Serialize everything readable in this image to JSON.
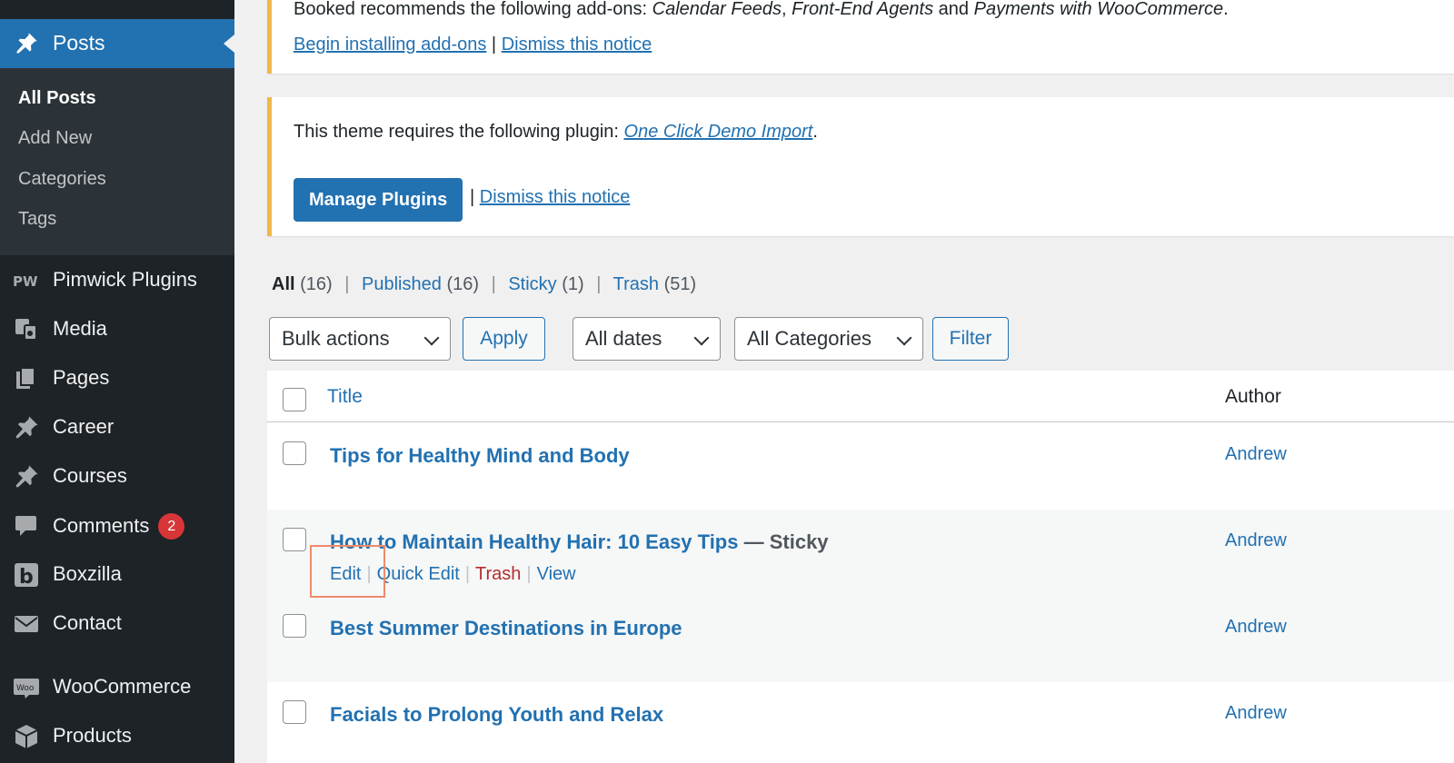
{
  "sidebar": {
    "current": {
      "label": "Posts",
      "icon": "pushpin-icon"
    },
    "submenu": [
      {
        "label": "All Posts",
        "current": true
      },
      {
        "label": "Add New"
      },
      {
        "label": "Categories"
      },
      {
        "label": "Tags"
      }
    ],
    "items": [
      {
        "label": "Pimwick Plugins",
        "icon": "pimwick-icon"
      },
      {
        "label": "Media",
        "icon": "media-icon"
      },
      {
        "label": "Pages",
        "icon": "pages-icon"
      },
      {
        "label": "Career",
        "icon": "pushpin-icon"
      },
      {
        "label": "Courses",
        "icon": "pushpin-icon"
      },
      {
        "label": "Comments",
        "icon": "comment-icon",
        "badge": "2"
      },
      {
        "label": "Boxzilla",
        "icon": "boxzilla-icon"
      },
      {
        "label": "Contact",
        "icon": "envelope-icon"
      },
      {
        "label": "WooCommerce",
        "icon": "woo-icon"
      },
      {
        "label": "Products",
        "icon": "products-icon"
      }
    ]
  },
  "notice1": {
    "text_prefix": "Booked recommends the following add-ons: ",
    "addon1": "Calendar Feeds",
    "sep1": ", ",
    "addon2": "Front-End Agents",
    "and": " and ",
    "addon3": "Payments with WooCommerce",
    "period": ".",
    "install_link": "Begin installing add-ons",
    "pipe": " | ",
    "dismiss_link": "Dismiss this notice"
  },
  "notice2": {
    "text_prefix": "This theme requires the following plugin: ",
    "plugin_link": "One Click Demo Import",
    "period": ".",
    "button": "Manage Plugins",
    "pipe": " | ",
    "dismiss_link": "Dismiss this notice"
  },
  "views": {
    "all": "All",
    "all_count": "(16)",
    "published": "Published",
    "published_count": "(16)",
    "sticky": "Sticky",
    "sticky_count": "(1)",
    "trash": "Trash",
    "trash_count": "(51)",
    "sep": "|"
  },
  "filters": {
    "bulk_actions": "Bulk actions",
    "apply": "Apply",
    "dates": "All dates",
    "categories": "All Categories",
    "filter": "Filter"
  },
  "table": {
    "col_title": "Title",
    "col_author": "Author",
    "rows": [
      {
        "title": "Tips for Healthy Mind and Body",
        "state": "",
        "author": "Andrew"
      },
      {
        "title": "How to Maintain Healthy Hair: 10 Easy Tips",
        "state": " — Sticky",
        "author": "Andrew"
      },
      {
        "title": "Best Summer Destinations in Europe",
        "state": "",
        "author": "Andrew"
      },
      {
        "title": "Facials to Prolong Youth and Relax",
        "state": "",
        "author": "Andrew"
      }
    ],
    "row_actions": {
      "edit": "Edit",
      "quick_edit": "Quick Edit",
      "trash": "Trash",
      "view": "View",
      "sep": "|"
    }
  },
  "colors": {
    "accent": "#2271b1",
    "sidebar": "#1d2327",
    "notice_border": "#f0b849",
    "trash": "#b32d2e",
    "badge": "#d63638",
    "highlight": "#f08a6a"
  }
}
